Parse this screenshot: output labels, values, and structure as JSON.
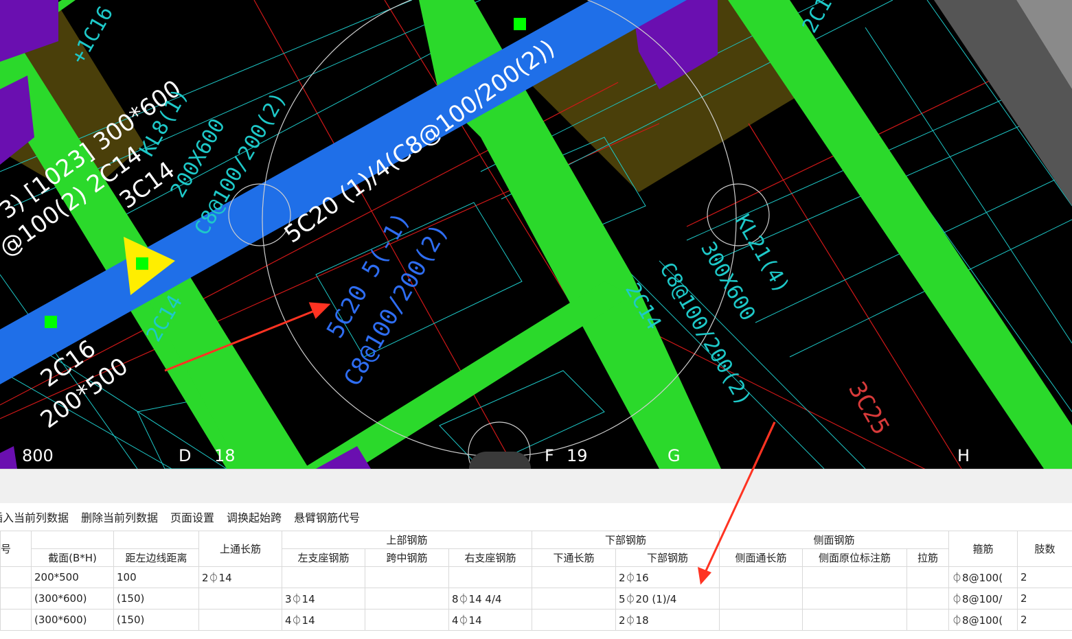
{
  "canvas": {
    "beam_labels_white": [
      "5C20 (1)/4(C8@100/200(2))",
      "3) [1023] 300*600",
      "@100(2) 2C14",
      "3C14",
      "2C16",
      "200*500"
    ],
    "beam_labels_cyan": [
      "KL8(1)",
      "200X600",
      "C8@100/200(2)",
      "C8@100/200(2)",
      "2C14",
      "KL21(4)",
      "300X600",
      "C8@100/200(2)",
      "2C14",
      "2C16",
      "+1C16"
    ],
    "beam_labels_blue": [
      "5C20 5(-1)",
      "C8@100/200(2)"
    ],
    "beam_label_red": "3C25",
    "axis_labels": [
      "800",
      "D",
      "18",
      "F",
      "19",
      "G",
      "H"
    ]
  },
  "toolbar": {
    "items": [
      "插入当前列数据",
      "删除当前列数据",
      "页面设置",
      "调换起始跨",
      "悬臂钢筋代号"
    ]
  },
  "table": {
    "group_headers": {
      "span_no": "号",
      "top_bars": "上部钢筋",
      "bottom_bars": "下部钢筋",
      "side_bars": "侧面钢筋",
      "stirrup": "箍筋",
      "legs": "肢数"
    },
    "headers": {
      "section": "截面(B*H)",
      "dist_left": "距左边线距离",
      "top_through": "上通长筋",
      "left_support": "左支座钢筋",
      "mid_span": "跨中钢筋",
      "right_support": "右支座钢筋",
      "bottom_through": "下通长筋",
      "bottom_bar": "下部钢筋",
      "side_through": "侧面通长筋",
      "side_in_situ": "侧面原位标注筋",
      "tie_bar": "拉筋"
    },
    "rows": [
      {
        "section": "200*500",
        "dist": "100",
        "top_through": "2⏀14",
        "left": "",
        "mid": "",
        "right": "",
        "bottom_through": "",
        "bottom": "2⏀16",
        "side_through": "",
        "side_situ": "",
        "tie": "",
        "stirrup": "⏀8@100(",
        "legs": "2"
      },
      {
        "section": "(300*600)",
        "dist": "(150)",
        "top_through": "",
        "left": "3⏀14",
        "mid": "",
        "right": "8⏀14 4/4",
        "bottom_through": "",
        "bottom": "5⏀20 (1)/4",
        "side_through": "",
        "side_situ": "",
        "tie": "",
        "stirrup": "⏀8@100/",
        "legs": "2"
      },
      {
        "section": "(300*600)",
        "dist": "(150)",
        "top_through": "",
        "left": "4⏀14",
        "mid": "",
        "right": "4⏀14",
        "bottom_through": "",
        "bottom": "2⏀18",
        "side_through": "",
        "side_situ": "",
        "tie": "",
        "stirrup": "⏀8@100(",
        "legs": "2"
      }
    ]
  },
  "colors": {
    "beam_green": "#2bd92b",
    "beam_blue": "#1f6fe8",
    "column_purple": "#6a0fb0",
    "slab_olive": "#4a3f0a",
    "cyan_line": "#1ec9c9",
    "red_line": "#d01818",
    "annotation_arrow": "#ff3322"
  }
}
